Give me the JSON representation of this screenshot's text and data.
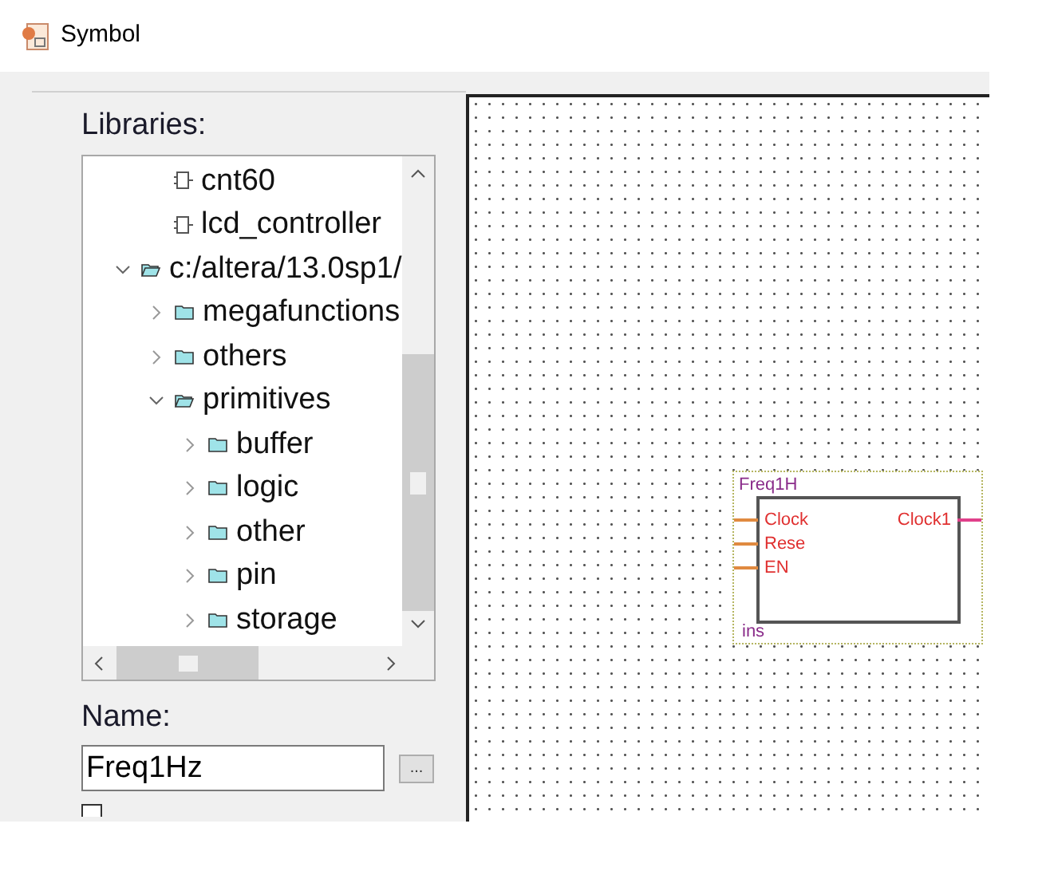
{
  "window": {
    "title": "Symbol"
  },
  "libraries": {
    "label": "Libraries:",
    "tree": [
      {
        "kind": "hidden",
        "children": [
          {
            "label": "cnt60",
            "kind": "symbol"
          },
          {
            "label": "lcd_controller",
            "kind": "symbol"
          }
        ]
      },
      {
        "label": "c:/altera/13.0sp1/",
        "kind": "folder",
        "expanded": true,
        "children": [
          {
            "label": "megafunctions",
            "kind": "folder",
            "expanded": false
          },
          {
            "label": "others",
            "kind": "folder",
            "expanded": false
          },
          {
            "label": "primitives",
            "kind": "folder",
            "expanded": true,
            "children": [
              {
                "label": "buffer",
                "kind": "folder",
                "expanded": false
              },
              {
                "label": "logic",
                "kind": "folder",
                "expanded": false
              },
              {
                "label": "other",
                "kind": "folder",
                "expanded": false
              },
              {
                "label": "pin",
                "kind": "folder",
                "expanded": false
              },
              {
                "label": "storage",
                "kind": "folder",
                "expanded": false
              }
            ]
          }
        ]
      }
    ]
  },
  "name": {
    "label": "Name:",
    "value": "Freq1Hz",
    "browse": "..."
  },
  "option": {
    "checked": false
  },
  "symbol": {
    "name": "Freq1H",
    "instance": "ins",
    "inputs": [
      "Clock",
      "Rese",
      "EN"
    ],
    "outputs": [
      "Clock1"
    ]
  }
}
